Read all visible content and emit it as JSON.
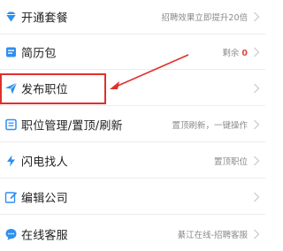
{
  "menu": {
    "items": [
      {
        "label": "开通套餐",
        "hint": "招聘效果立即提升20倍",
        "icon": "diamond-icon"
      },
      {
        "label": "简历包",
        "hint_prefix": "剩余",
        "hint_count": "0",
        "icon": "resume-pack-icon"
      },
      {
        "label": "发布职位",
        "hint": "",
        "icon": "send-plane-icon"
      },
      {
        "label": "职位管理/置顶/刷新",
        "hint": "置顶刷新，一键操作",
        "icon": "list-icon"
      },
      {
        "label": "闪电找人",
        "hint": "置顶职位",
        "icon": "lightning-icon"
      },
      {
        "label": "编辑公司",
        "hint": "",
        "icon": "edit-icon"
      },
      {
        "label": "在线客服",
        "hint": "綦江在线-招聘客服",
        "icon": "chat-bubble-icon"
      }
    ]
  },
  "colors": {
    "accent": "#2f8ff0",
    "annotation_red": "#e0302a",
    "count_red": "#e2463a"
  }
}
